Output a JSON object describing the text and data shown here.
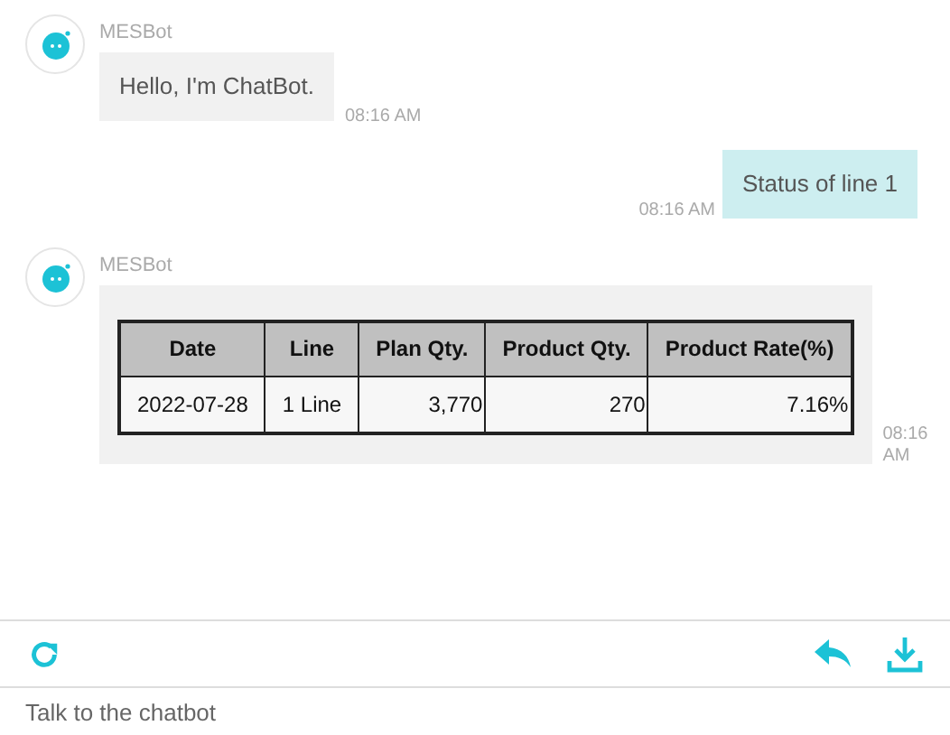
{
  "messages": [
    {
      "kind": "bot_text",
      "sender": "MESBot",
      "text": "Hello, I'm ChatBot.",
      "time": "08:16 AM"
    },
    {
      "kind": "user_text",
      "text": "Status of line 1",
      "time": "08:16 AM"
    },
    {
      "kind": "bot_table",
      "sender": "MESBot",
      "time": "08:16 AM",
      "table": {
        "columns": [
          "Date",
          "Line",
          "Plan Qty.",
          "Product Qty.",
          "Product Rate(%)"
        ],
        "rows": [
          [
            "2022-07-28",
            "1 Line",
            "3,770",
            "270",
            "7.16%"
          ]
        ]
      }
    }
  ],
  "input": {
    "placeholder": "Talk to the chatbot"
  }
}
